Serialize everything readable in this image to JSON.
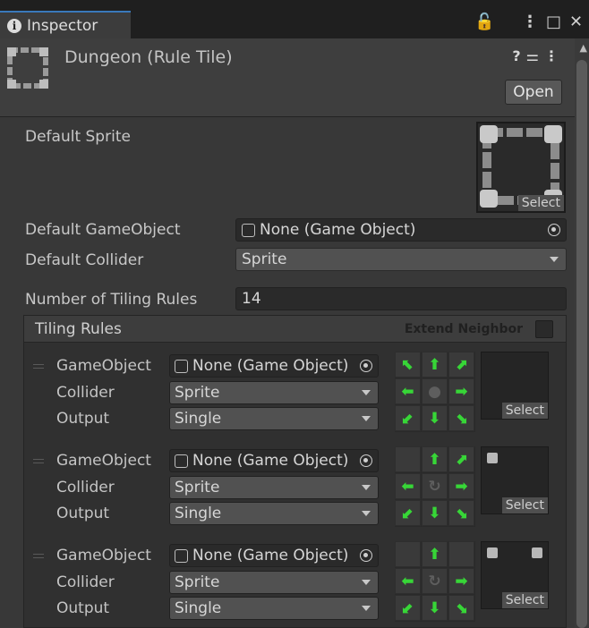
{
  "tab": {
    "label": "Inspector",
    "info_glyph": "i"
  },
  "window_controls": [
    "lock-icon",
    "more-icon",
    "maximize-icon",
    "close-icon"
  ],
  "window_glyphs": {
    "lock": "🔓",
    "more": "⋮",
    "maximize": "□",
    "close": "✕"
  },
  "header": {
    "title": "Dungeon (Rule Tile)",
    "icons": [
      "help-icon",
      "settings-sliders-icon",
      "more-icon"
    ],
    "icon_glyphs": "❓⚌⋮",
    "open_button": "Open"
  },
  "fields": {
    "default_sprite_label": "Default Sprite",
    "sprite_select": "Select",
    "default_gameobject_label": "Default GameObject",
    "default_gameobject_value": "None (Game Object)",
    "default_collider_label": "Default Collider",
    "default_collider_value": "Sprite",
    "tiling_rules_count_label": "Number of Tiling Rules",
    "tiling_rules_count_value": "14"
  },
  "tiling_rules": {
    "title": "Tiling Rules",
    "extend_neighbor_label": "Extend Neighbor",
    "rule_labels": {
      "gameobject": "GameObject",
      "collider": "Collider",
      "output": "Output"
    },
    "rules": [
      {
        "gameobject": "None (Game Object)",
        "collider": "Sprite",
        "output": "Single",
        "select": "Select",
        "grid": [
          "⬉",
          "⬆",
          "⬈",
          "⬅",
          "●",
          "➡",
          "⬋",
          "⬇",
          "⬊"
        ]
      },
      {
        "gameobject": "None (Game Object)",
        "collider": "Sprite",
        "output": "Single",
        "select": "Select",
        "grid": [
          "",
          "⬆",
          "⬈",
          "⬅",
          "↻",
          "➡",
          "⬋",
          "⬇",
          "⬊"
        ]
      },
      {
        "gameobject": "None (Game Object)",
        "collider": "Sprite",
        "output": "Single",
        "select": "Select",
        "grid": [
          "",
          "⬆",
          "",
          "⬅",
          "↻",
          "➡",
          "⬋",
          "⬇",
          "⬊"
        ]
      }
    ]
  },
  "colors": {
    "accent": "#3a79bb",
    "arrow_green": "#37d637",
    "panel_bg": "#383838"
  }
}
